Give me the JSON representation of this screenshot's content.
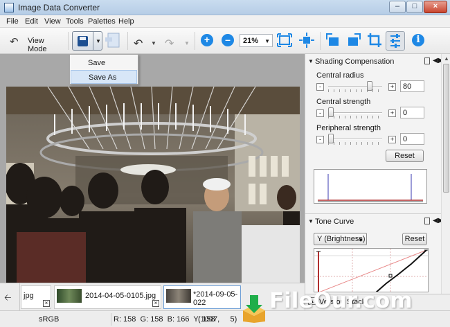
{
  "window": {
    "title": "Image Data Converter"
  },
  "menu": [
    "File",
    "Edit",
    "View",
    "Tools",
    "Palettes",
    "Help"
  ],
  "toolbar": {
    "view_mode_label": "View Mode",
    "zoom_value": "21%"
  },
  "save_menu": {
    "items": [
      "Save",
      "Save As"
    ],
    "highlighted": "Save As"
  },
  "panel": {
    "shading": {
      "title": "Shading Compensation",
      "central_radius": {
        "label": "Central radius",
        "value": "80",
        "level": 0.8
      },
      "central_strength": {
        "label": "Central strength",
        "value": "0",
        "level": 0
      },
      "peripheral_strength": {
        "label": "Peripheral strength",
        "value": "0",
        "level": 0
      },
      "reset_label": "Reset"
    },
    "tone_curve": {
      "title": "Tone Curve",
      "channel": "Y (Brightness)",
      "reset_label": "Reset"
    },
    "version_stack": {
      "title": "Version Stack"
    }
  },
  "filmstrip": {
    "items": [
      {
        "name": "jpg"
      },
      {
        "name": "2014-04-05-0105.jpg"
      },
      {
        "name": "*2014-09-05-022"
      }
    ]
  },
  "status": {
    "colorspace": "sRGB",
    "pixel": "R: 158  G: 158  B: 166  Y: 158",
    "coords": "(1007,     5)"
  },
  "watermark": {
    "text": "FileOur.com"
  },
  "colors": {
    "accent": "#1e88e5",
    "titlebar": "#b6cde6",
    "close": "#c9452f"
  }
}
